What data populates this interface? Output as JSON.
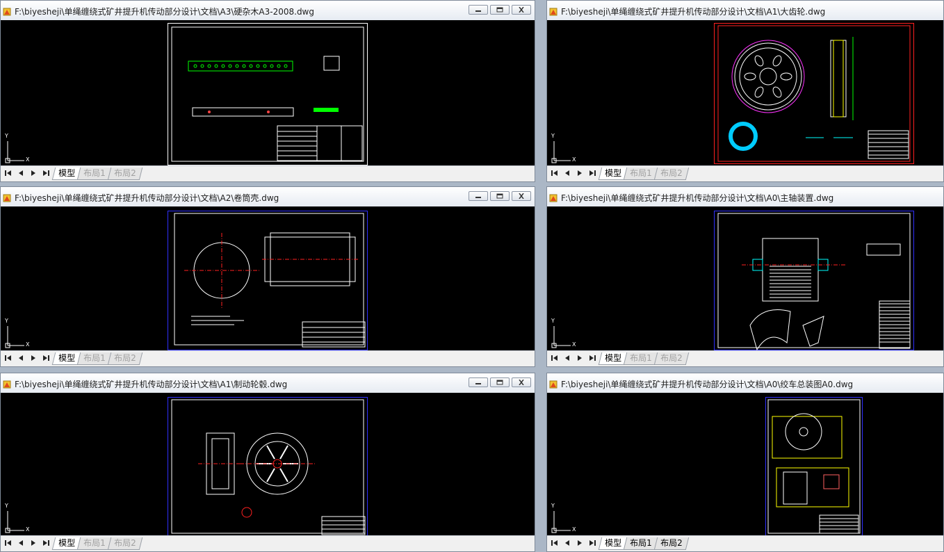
{
  "windows": [
    {
      "title": "F:\\biyesheji\\单绳缠绕式矿井提升机传动部分设计\\文档\\A3\\硬杂木A3-2008.dwg",
      "tabs": [
        "模型",
        "布局1",
        "布局2"
      ],
      "active_tab": 0
    },
    {
      "title": "F:\\biyesheji\\单绳缠绕式矿井提升机传动部分设计\\文档\\A1\\大齿轮.dwg",
      "tabs": [
        "模型",
        "布局1",
        "布局2"
      ],
      "active_tab": 0
    },
    {
      "title": "F:\\biyesheji\\单绳缠绕式矿井提升机传动部分设计\\文档\\A2\\卷筒壳.dwg",
      "tabs": [
        "模型",
        "布局1",
        "布局2"
      ],
      "active_tab": 0
    },
    {
      "title": "F:\\biyesheji\\单绳缠绕式矿井提升机传动部分设计\\文档\\A0\\主轴装置.dwg",
      "tabs": [
        "模型",
        "布局1",
        "布局2"
      ],
      "active_tab": 0
    },
    {
      "title": "F:\\biyesheji\\单绳缠绕式矿井提升机传动部分设计\\文档\\A1\\制动轮毂.dwg",
      "tabs": [
        "模型",
        "布局1",
        "布局2"
      ],
      "active_tab": 0
    },
    {
      "title": "F:\\biyesheji\\单绳缠绕式矿井提升机传动部分设计\\文档\\A0\\绞车总装图A0.dwg",
      "tabs": [
        "模型",
        "布局1",
        "布局2"
      ],
      "active_tab": 0
    }
  ],
  "ucs": {
    "x_label": "X",
    "y_label": "Y"
  },
  "icons": {
    "doc": "dwg-document-icon",
    "minimize": "minimize-icon",
    "restore": "restore-icon",
    "close": "close-icon"
  }
}
